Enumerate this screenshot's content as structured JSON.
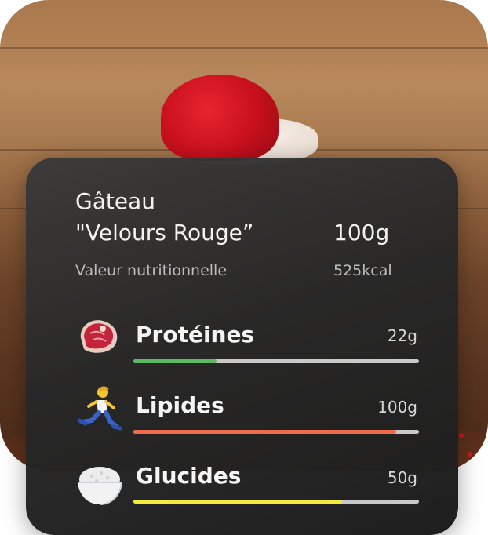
{
  "food": {
    "title_line1": "Gâteau",
    "title_line2": "\"Velours Rouge”",
    "portion": "100g",
    "nutrition_label": "Valeur nutritionnelle",
    "energy": "525kcal"
  },
  "macros": [
    {
      "label": "Protéines",
      "value": "22g",
      "icon": "steak-icon",
      "bar_fraction": 0.29,
      "bar_color": "#5dbb63"
    },
    {
      "label": "Lipides",
      "value": "100g",
      "icon": "runner-icon",
      "bar_fraction": 0.92,
      "bar_color": "#f16a4a"
    },
    {
      "label": "Glucides",
      "value": "50g",
      "icon": "rice-bowl-icon",
      "bar_fraction": 0.73,
      "bar_color": "#f4ea3e"
    }
  ],
  "colors": {
    "card": "#2e2e2e",
    "track": "#c9c9c9"
  }
}
